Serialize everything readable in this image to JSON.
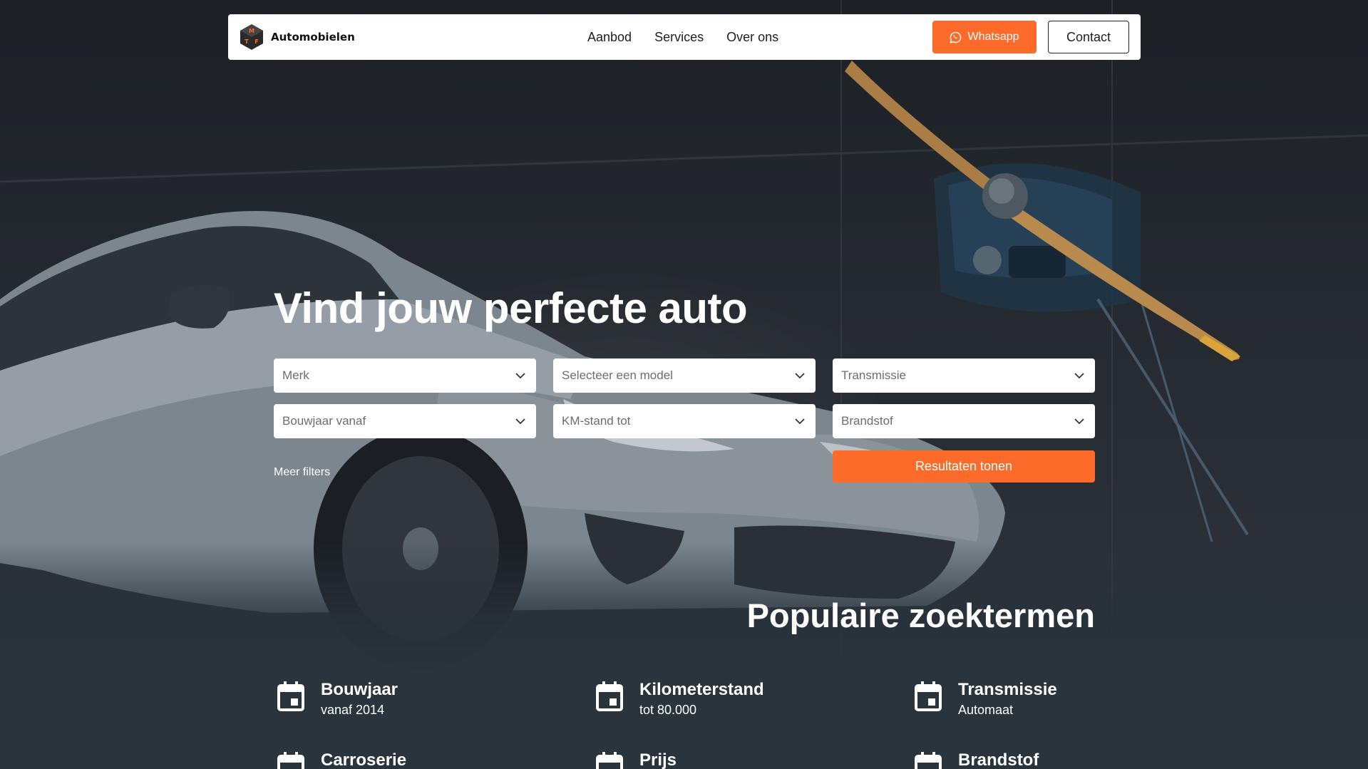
{
  "brand": {
    "logo_letters": [
      "M",
      "T",
      "F"
    ],
    "name": "Automobielen"
  },
  "nav": {
    "links": [
      "Aanbod",
      "Services",
      "Over ons"
    ],
    "whatsapp_label": "Whatsapp",
    "contact_label": "Contact"
  },
  "hero": {
    "title": "Vind jouw perfecte auto",
    "filters": {
      "merk": "Merk",
      "model": "Selecteer een model",
      "transmissie": "Transmissie",
      "bouwjaar": "Bouwjaar vanaf",
      "kmstand": "KM-stand tot",
      "brandstof": "Brandstof"
    },
    "meer_filters": "Meer filters",
    "results_label": "Resultaten tonen"
  },
  "popular": {
    "title": "Populaire zoektermen",
    "terms": [
      {
        "title": "Bouwjaar",
        "sub": "vanaf 2014"
      },
      {
        "title": "Kilometerstand",
        "sub": "tot 80.000"
      },
      {
        "title": "Transmissie",
        "sub": "Automaat"
      },
      {
        "title": "Carroserie",
        "sub": ""
      },
      {
        "title": "Prijs",
        "sub": ""
      },
      {
        "title": "Brandstof",
        "sub": ""
      }
    ]
  },
  "colors": {
    "accent": "#fd6b2a",
    "navbar_bg": "#ffffff",
    "text_dark": "#1e1e1e"
  },
  "icons": {
    "whatsapp": "whatsapp-icon",
    "chevron": "chevron-down-icon",
    "calendar": "calendar-icon"
  }
}
